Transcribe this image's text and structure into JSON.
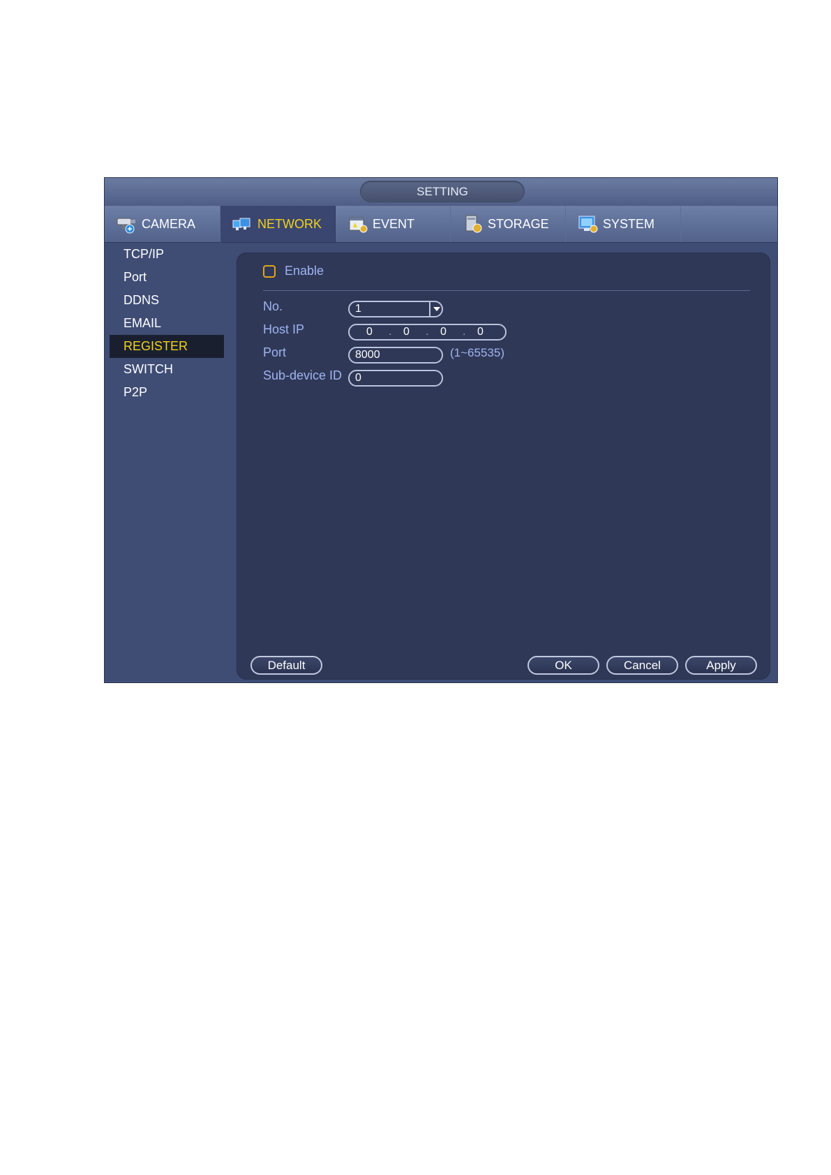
{
  "window": {
    "title": "SETTING"
  },
  "tabs": [
    {
      "label": "CAMERA",
      "icon": "camera-icon",
      "active": false
    },
    {
      "label": "NETWORK",
      "icon": "network-icon",
      "active": true
    },
    {
      "label": "EVENT",
      "icon": "event-icon",
      "active": false
    },
    {
      "label": "STORAGE",
      "icon": "storage-icon",
      "active": false
    },
    {
      "label": "SYSTEM",
      "icon": "system-icon",
      "active": false
    }
  ],
  "sidebar": {
    "items": [
      {
        "label": "TCP/IP"
      },
      {
        "label": "Port"
      },
      {
        "label": "DDNS"
      },
      {
        "label": "EMAIL"
      },
      {
        "label": "REGISTER",
        "active": true
      },
      {
        "label": "SWITCH"
      },
      {
        "label": "P2P"
      }
    ]
  },
  "form": {
    "enable": {
      "label": "Enable",
      "checked": false
    },
    "no": {
      "label": "No.",
      "value": "1"
    },
    "host_ip": {
      "label": "Host IP",
      "octets": [
        "0",
        "0",
        "0",
        "0"
      ],
      "separator": "."
    },
    "port": {
      "label": "Port",
      "value": "8000",
      "range": "(1~65535)"
    },
    "sub_device_id": {
      "label": "Sub-device ID",
      "value": "0"
    }
  },
  "buttons": {
    "default": "Default",
    "ok": "OK",
    "cancel": "Cancel",
    "apply": "Apply"
  },
  "colors": {
    "active_text": "#f2d31b",
    "label_text": "#9fb4f2",
    "panel_bg": "#2f3856",
    "window_bg": "#3f4d75"
  }
}
